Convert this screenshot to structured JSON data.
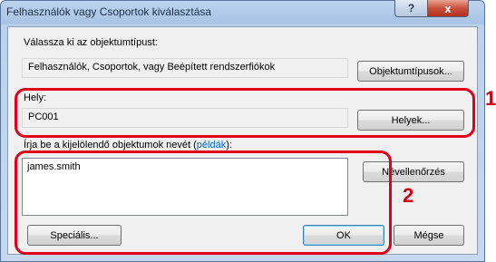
{
  "window": {
    "title": "Felhasználók vagy Csoportok kiválasztása",
    "help_label": "?",
    "close_label": "x"
  },
  "object_type": {
    "label": "Válassza ki az objektumtípust:",
    "value": "Felhasználók, Csoportok, vagy Beépített rendszerfiókok",
    "button": "Objektumtípusok..."
  },
  "location": {
    "label": "Hely:",
    "value": "PC001",
    "button": "Helyek..."
  },
  "names": {
    "label_prefix": "Írja be a kijelölendő objektumok nevét (",
    "label_link": "példák",
    "label_suffix": "):",
    "value": "james.smith",
    "check_button": "Névellenőrzés"
  },
  "footer": {
    "advanced_button": "Speciális...",
    "ok_button": "OK",
    "cancel_button": "Mégse"
  },
  "annotations": {
    "marker_1": "1",
    "marker_2": "2",
    "highlight_color": "#e0001b"
  }
}
